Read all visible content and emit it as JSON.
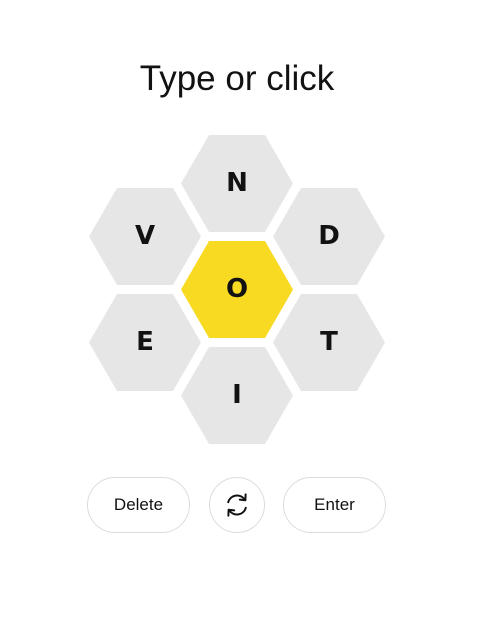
{
  "prompt": "Type or click",
  "hive": {
    "center_letter": "O",
    "outer_letters": [
      "N",
      "V",
      "D",
      "E",
      "T",
      "I"
    ],
    "center_color": "#f7da21",
    "outer_color": "#e6e6e6"
  },
  "controls": {
    "delete_label": "Delete",
    "shuffle_icon": "shuffle-icon",
    "enter_label": "Enter"
  }
}
